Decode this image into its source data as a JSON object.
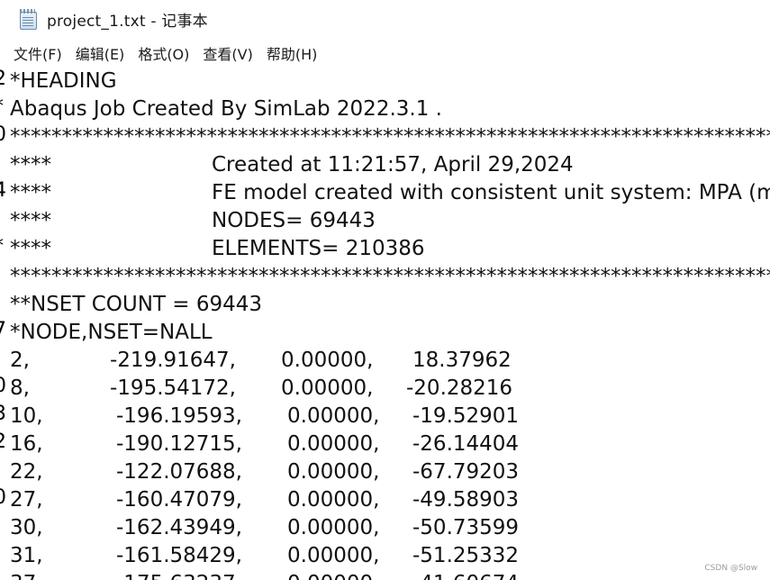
{
  "window": {
    "title": "project_1.txt - 记事本",
    "icon": "notepad-icon"
  },
  "menu": [
    {
      "label": "文件(F)",
      "id": "file"
    },
    {
      "label": "编辑(E)",
      "id": "edit"
    },
    {
      "label": "格式(O)",
      "id": "format"
    },
    {
      "label": "查看(V)",
      "id": "view"
    },
    {
      "label": "帮助(H)",
      "id": "help"
    }
  ],
  "gutter": [
    ",",
    "2",
    "*",
    "0",
    ",",
    "4",
    ",",
    "*",
    ",",
    ",",
    "7",
    ",",
    "0",
    "3",
    "2",
    ",",
    "0",
    ",",
    ","
  ],
  "header_lines": [
    "*HEADING",
    "Abaqus Job Created By SimLab 2022.3.1 .",
    "******************************************************************************************************************"
  ],
  "info_lines": [
    {
      "prefix": "****",
      "text": "Created at 11:21:57, April 29,2024"
    },
    {
      "prefix": "****",
      "text": "FE model created with consistent unit system: MPA (mm)"
    },
    {
      "prefix": "****",
      "text": "NODES= 69443"
    },
    {
      "prefix": "****",
      "text": "ELEMENTS= 210386"
    }
  ],
  "separator": "******************************************************************************************************************",
  "nset_lines": [
    "**NSET COUNT = 69443",
    "*NODE,NSET=NALL"
  ],
  "nodes": [
    {
      "id": "2,",
      "x": "-219.91647,",
      "y": "0.00000,",
      "z": "18.37962"
    },
    {
      "id": "8,",
      "x": "-195.54172,",
      "y": "0.00000,",
      "z": "-20.28216"
    },
    {
      "id": "10,",
      "x": "-196.19593,",
      "y": "0.00000,",
      "z": "-19.52901"
    },
    {
      "id": "16,",
      "x": "-190.12715,",
      "y": "0.00000,",
      "z": "-26.14404"
    },
    {
      "id": "22,",
      "x": "-122.07688,",
      "y": "0.00000,",
      "z": "-67.79203"
    },
    {
      "id": "27,",
      "x": "-160.47079,",
      "y": "0.00000,",
      "z": "-49.58903"
    },
    {
      "id": "30,",
      "x": "-162.43949,",
      "y": "0.00000,",
      "z": "-50.73599"
    },
    {
      "id": "31,",
      "x": "-161.58429,",
      "y": "0.00000,",
      "z": "-51.25332"
    },
    {
      "id": "37,",
      "x": "-175.63237,",
      "y": "0.00000,",
      "z": "-41.60674"
    }
  ],
  "watermark": "CSDN @Slow"
}
